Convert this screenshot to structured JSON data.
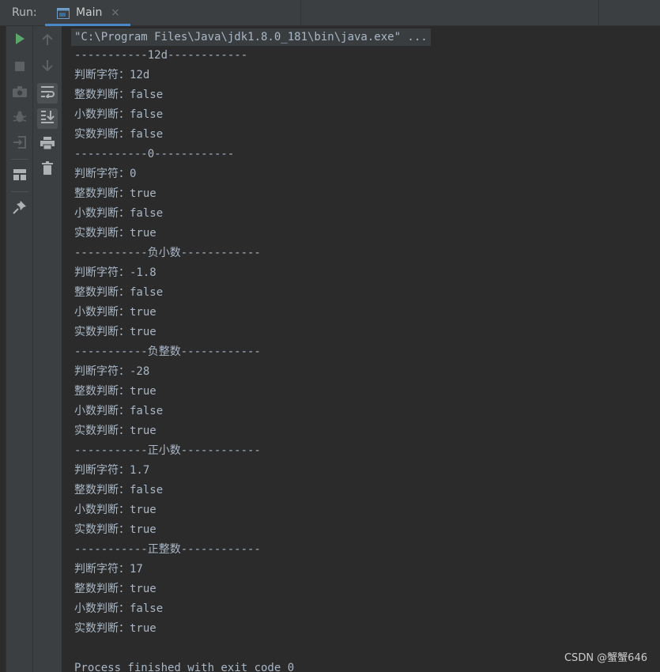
{
  "header": {
    "run_label": "Run:",
    "tab": {
      "label": "Main",
      "close": "×"
    }
  },
  "toolbar_left": [
    {
      "name": "rerun-icon",
      "color": "#59a869"
    },
    {
      "name": "stop-icon",
      "color": "#5e6163"
    },
    {
      "name": "camera-icon",
      "color": "#5e6163"
    },
    {
      "name": "debug-bug-icon",
      "color": "#5e6163"
    },
    {
      "name": "exit-icon",
      "color": "#5e6163"
    },
    {
      "name": "layout-icon",
      "color": "#afb1b3"
    },
    {
      "name": "pin-icon",
      "color": "#afb1b3"
    }
  ],
  "toolbar_right": [
    {
      "name": "up-arrow-icon"
    },
    {
      "name": "down-arrow-icon"
    },
    {
      "name": "soft-wrap-icon",
      "active": true
    },
    {
      "name": "scroll-to-end-icon",
      "active": true
    },
    {
      "name": "print-icon"
    },
    {
      "name": "trash-icon"
    }
  ],
  "console": {
    "command": "\"C:\\Program Files\\Java\\jdk1.8.0_181\\bin\\java.exe\" ...",
    "lines": [
      "-----------12d------------",
      "判断字符：12d",
      "整数判断：false",
      "小数判断：false",
      "实数判断：false",
      "-----------0------------",
      "判断字符：0",
      "整数判断：true",
      "小数判断：false",
      "实数判断：true",
      "-----------负小数------------",
      "判断字符：-1.8",
      "整数判断：false",
      "小数判断：true",
      "实数判断：true",
      "-----------负整数------------",
      "判断字符：-28",
      "整数判断：true",
      "小数判断：false",
      "实数判断：true",
      "-----------正小数------------",
      "判断字符：1.7",
      "整数判断：false",
      "小数判断：true",
      "实数判断：true",
      "-----------正整数------------",
      "判断字符：17",
      "整数判断：true",
      "小数判断：false",
      "实数判断：true",
      "",
      "Process finished with exit code 0"
    ]
  },
  "watermark": "CSDN @蟹蟹646",
  "colors": {
    "console_bg": "#2b2b2b",
    "panel_bg": "#3c3f41",
    "text": "#a9b7c6",
    "accent": "#4a88c7"
  }
}
